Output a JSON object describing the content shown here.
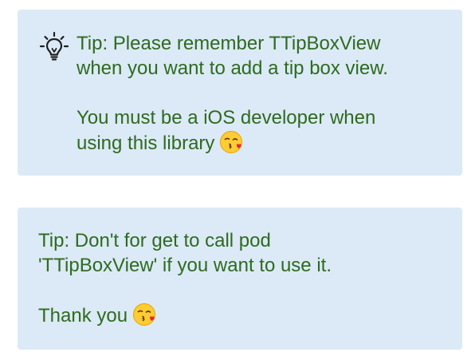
{
  "tips": [
    {
      "icon": "lightbulb-icon",
      "line1": "Tip: Please remember TTipBoxView",
      "line2": "when you want to add a tip box view.",
      "line3": "",
      "line4": "You must be a iOS developer when",
      "line5": "using this library",
      "emoji": "kissing-face-emoji"
    },
    {
      "line1": "Tip: Don't for get to call pod",
      "line2": "'TTipBoxView' if you want to use it.",
      "line3": "",
      "line4": "Thank you",
      "emoji": "kissing-face-emoji"
    }
  ],
  "colors": {
    "box_background": "#dbeaf6",
    "text": "#2f6a1f"
  }
}
